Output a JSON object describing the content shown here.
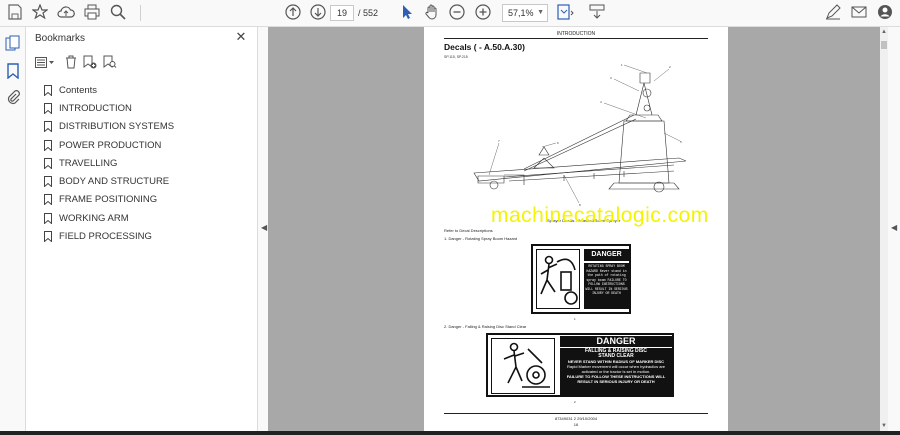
{
  "toolbar": {
    "page_current": "19",
    "page_total": "/ 552",
    "zoom": "57,1%",
    "icons": [
      "save-icon",
      "bookmark-star-icon",
      "upload-icon",
      "print-icon",
      "zoom-search-icon",
      "page-up-icon",
      "page-down-icon",
      "select-cursor-icon",
      "hand-icon",
      "zoom-out-icon",
      "zoom-in-icon",
      "fit-page-icon",
      "scroll-mode-icon",
      "sign-icon",
      "email-icon",
      "account-icon"
    ]
  },
  "sidebar": {
    "title": "Bookmarks",
    "items": [
      {
        "label": "Contents"
      },
      {
        "label": "INTRODUCTION"
      },
      {
        "label": "DISTRIBUTION SYSTEMS"
      },
      {
        "label": "POWER PRODUCTION"
      },
      {
        "label": "TRAVELLING"
      },
      {
        "label": "BODY AND STRUCTURE"
      },
      {
        "label": "FRAME POSITIONING"
      },
      {
        "label": "WORKING ARM"
      },
      {
        "label": "FIELD PROCESSING"
      }
    ]
  },
  "document": {
    "header": "INTRODUCTION",
    "title": "Decals ( - A.50.A.30)",
    "subtitle": "SP.115, SP.215",
    "section_caption": "Sprayer Decals - Wheeled Boom Sprayer",
    "refer": "Refer to Decal Descriptions",
    "item1": "1.    Danger - Rotating Spray Boom Hazard",
    "item2": "2.    Danger - Falling & Raising Disc Stand Clear",
    "decal1": {
      "heading": "DANGER",
      "text": "ROTATING SPRAY BOOM HAZARD Never stand in the path of rotating spray boom FAILURE TO FOLLOW INSTRUCTIONS WILL RESULT IN SERIOUS INJURY OR DEATH"
    },
    "decal2": {
      "heading": "DANGER",
      "line1": "FALLING & RAISING DISC",
      "line2": "STAND CLEAR",
      "line3": "NEVER STAND WITHIN RADIUS OF MARKER DISC",
      "line4": "Rapid Marker movement will occur when hydraulics are activated or the tractor is set in motion.",
      "line5": "FAILURE TO FOLLOW THESE INSTRUCTIONS WILL RESULT IN SERIOUS INJURY OR DEATH"
    },
    "footer_code": "87349031 2 29/10/2004",
    "footer_page": "16"
  },
  "watermark": "machinecatalogic.com"
}
